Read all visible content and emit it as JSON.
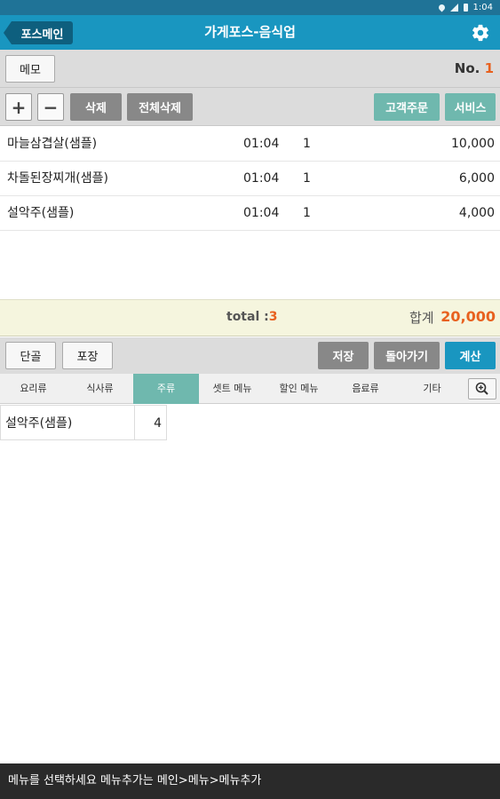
{
  "status_bar": {
    "time": "1:04"
  },
  "action_bar": {
    "back_label": "포스메인",
    "title": "가게포스-음식업"
  },
  "memo_row": {
    "memo_label": "메모",
    "order_no_label": "No.",
    "order_no_value": "1"
  },
  "toolbar": {
    "plus_label": "+",
    "minus_label": "−",
    "delete_label": "삭제",
    "delete_all_label": "전체삭제",
    "customer_order_label": "고객주문",
    "service_label": "서비스"
  },
  "order_items": [
    {
      "name": "마늘삼겹살(샘플)",
      "time": "01:04",
      "qty": "1",
      "price": "10,000"
    },
    {
      "name": "차돌된장찌개(샘플)",
      "time": "01:04",
      "qty": "1",
      "price": "6,000"
    },
    {
      "name": "설악주(샘플)",
      "time": "01:04",
      "qty": "1",
      "price": "4,000"
    }
  ],
  "totals": {
    "total_label": "total :",
    "total_count": "3",
    "sum_label": "합계",
    "sum_value": "20,000"
  },
  "actions": {
    "dangol_label": "단골",
    "pack_label": "포장",
    "save_label": "저장",
    "back_label": "돌아가기",
    "checkout_label": "계산"
  },
  "categories": [
    {
      "label": "요리류",
      "active": false
    },
    {
      "label": "식사류",
      "active": false
    },
    {
      "label": "주류",
      "active": true
    },
    {
      "label": "셋트 메뉴",
      "active": false
    },
    {
      "label": "할인 메뉴",
      "active": false
    },
    {
      "label": "음료류",
      "active": false
    },
    {
      "label": "기타",
      "active": false
    }
  ],
  "menu_items": [
    {
      "name": "설악주(샘플)",
      "qty": "4"
    }
  ],
  "hint": {
    "text": "메뉴를 선택하세요 메뉴추가는 메인>메뉴>메뉴추가"
  },
  "colors": {
    "accent": "#1996c0",
    "teal": "#6fb8ae",
    "highlight": "#e8611f"
  }
}
